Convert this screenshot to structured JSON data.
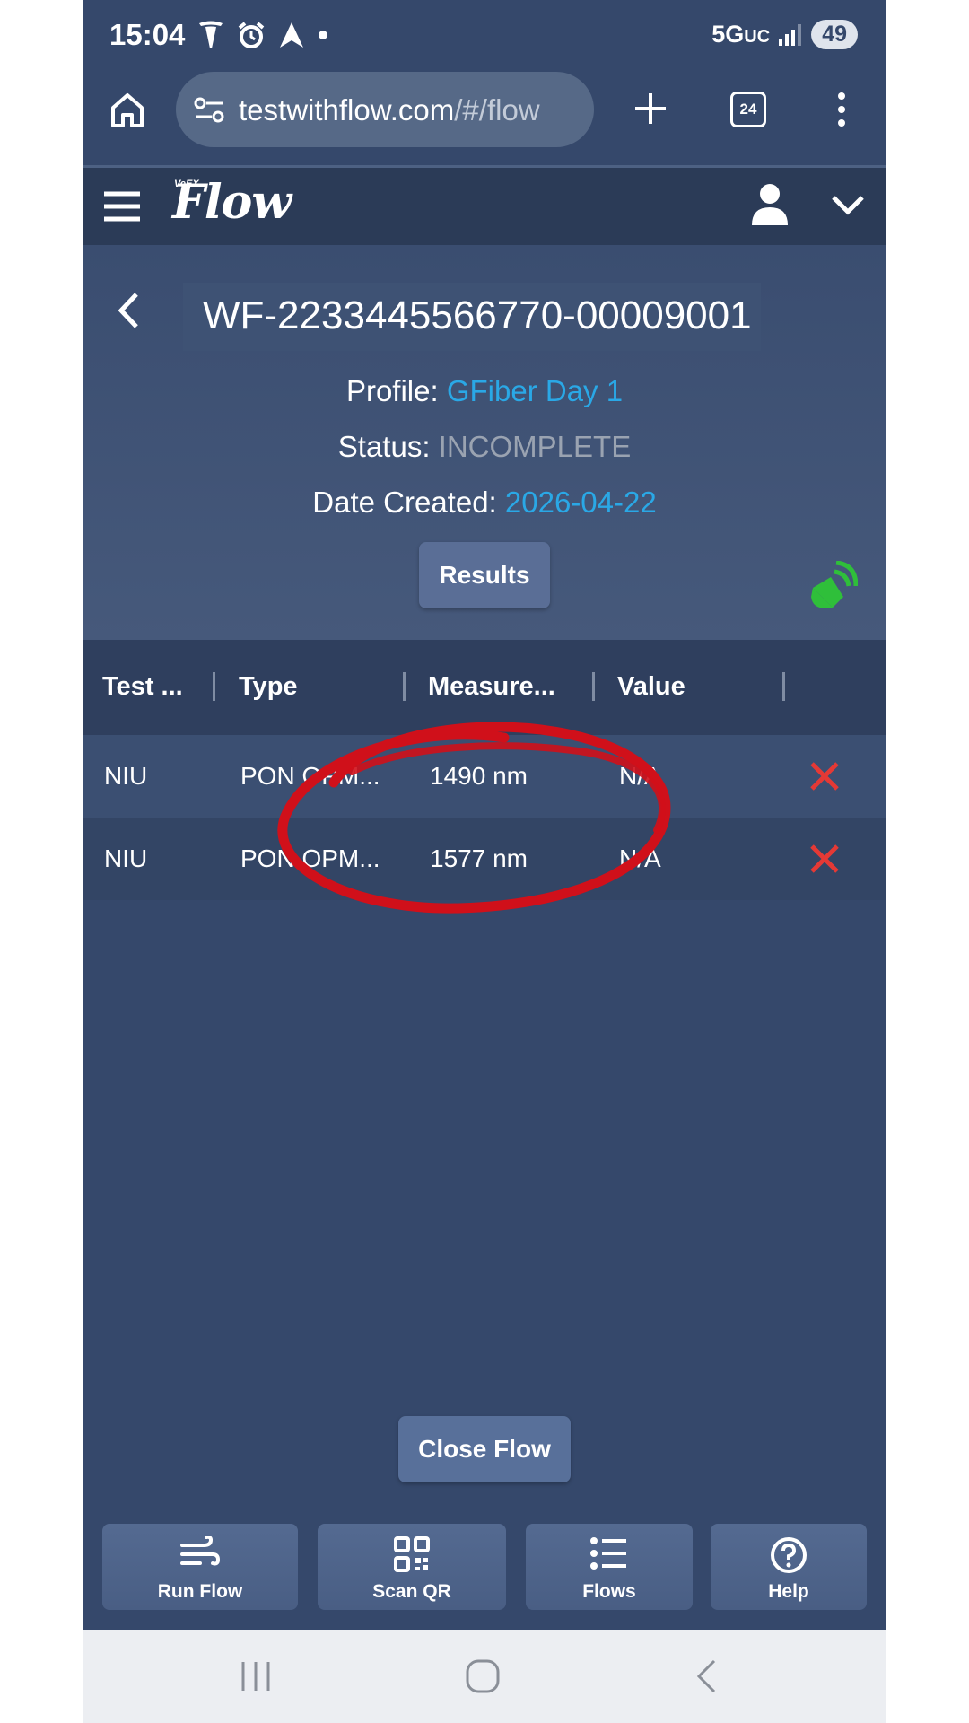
{
  "status_bar": {
    "time": "15:04",
    "network_main": "5G",
    "network_sub": "UC",
    "battery": "49"
  },
  "browser": {
    "url_host": "testwithflow.com",
    "url_path": "/#/flow",
    "tab_count": "24"
  },
  "app": {
    "logo_small": "VeEX",
    "logo": "Flow"
  },
  "flow": {
    "id": "WF-2233445566770-00009001",
    "profile_label": "Profile:",
    "profile_value": "GFiber Day 1",
    "status_label": "Status:",
    "status_value": "INCOMPLETE",
    "date_label": "Date Created:",
    "date_value": "2026-04-22",
    "results_button": "Results"
  },
  "table": {
    "headers": [
      "Test ...",
      "Type",
      "Measure...",
      "Value"
    ],
    "rows": [
      {
        "test": "NIU",
        "type": "PON OPM...",
        "measure": "1490 nm",
        "value": "N/A",
        "result": "fail"
      },
      {
        "test": "NIU",
        "type": "PON OPM...",
        "measure": "1577 nm",
        "value": "N/A",
        "result": "fail"
      }
    ]
  },
  "close_flow_button": "Close Flow",
  "bottom_nav": [
    {
      "label": "Run Flow",
      "icon": "wind-icon"
    },
    {
      "label": "Scan QR",
      "icon": "qr-code-icon"
    },
    {
      "label": "Flows",
      "icon": "list-icon"
    },
    {
      "label": "Help",
      "icon": "help-circle-icon"
    }
  ],
  "colors": {
    "background": "#35486b",
    "header": "#2b3b57",
    "link_blue": "#2aa8e6",
    "status_grey": "#9aa3b1",
    "fail_red": "#e53935",
    "annotation_red": "#d0101a",
    "connected_green": "#2fbf3a"
  }
}
